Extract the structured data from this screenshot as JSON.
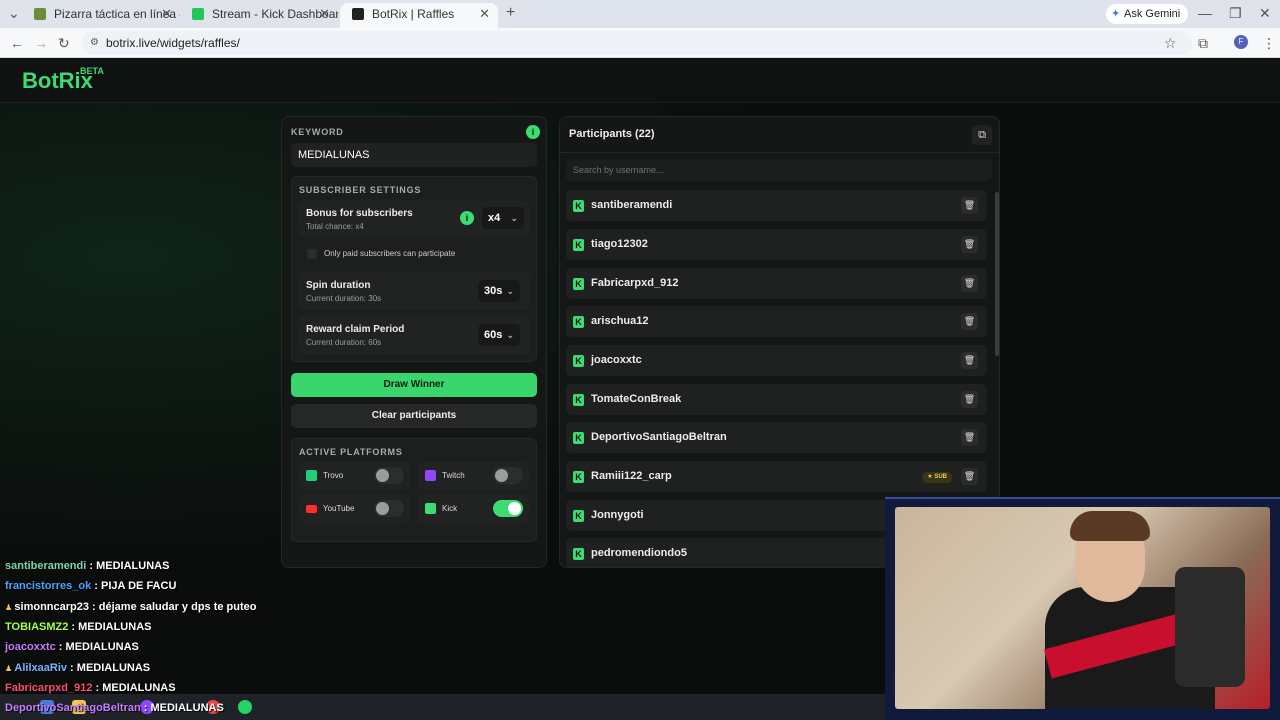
{
  "browser": {
    "tabs": [
      {
        "title": "Pizarra táctica en línea – Fútbol",
        "color": "#6b8e3a"
      },
      {
        "title": "Stream - Kick Dashboard",
        "color": "#22c55e"
      },
      {
        "title": "BotRix | Raffles",
        "color": "#222222"
      }
    ],
    "url": "botrix.live/widgets/raffles/",
    "gemini": "Ask Gemini",
    "profile": "F"
  },
  "app": {
    "logo": "BotRix",
    "beta": "BETA"
  },
  "raffle": {
    "keyword_label": "KEYWORD",
    "keyword_value": "MEDIALUNAS",
    "subscriber_settings": "SUBSCRIBER SETTINGS",
    "bonus_title": "Bonus for subscribers",
    "bonus_sub": "Total chance: x4",
    "bonus_value": "x4",
    "paid_only": "Only paid subscribers can participate",
    "spin_title": "Spin duration",
    "spin_sub": "Current duration: 30s",
    "spin_value": "30s",
    "reward_title": "Reward claim Period",
    "reward_sub": "Current duration: 60s",
    "reward_value": "60s",
    "draw_btn": "Draw Winner",
    "clear_btn": "Clear participants",
    "active_platforms": "ACTIVE PLATFORMS",
    "platforms": [
      {
        "name": "Trovo",
        "on": false
      },
      {
        "name": "Twitch",
        "on": false
      },
      {
        "name": "YouTube",
        "on": false
      },
      {
        "name": "Kick",
        "on": true
      }
    ]
  },
  "participants": {
    "title": "Participants (22)",
    "search_placeholder": "Search by username...",
    "sub_badge": "★ SUB",
    "list": [
      "santiberamendi",
      "tiago12302",
      "Fabricarpxd_912",
      "arischua12",
      "joacoxxtc",
      "TomateConBreak",
      "DeportivoSantiagoBeltran",
      "Ramiii122_carp",
      "Jonnygoti",
      "pedromendiondo5"
    ]
  },
  "chat": [
    {
      "user": "santiberamendi",
      "msg": "MEDIALUNAS",
      "color": "#7dd8a8"
    },
    {
      "user": "francistorres_ok",
      "msg": "PIJA DE FACU",
      "color": "#4aa3ff"
    },
    {
      "user": "simonncarp23",
      "msg": "déjame saludar y dps te puteo",
      "color": "#ffffff"
    },
    {
      "user": "TOBIASMZ2",
      "msg": "MEDIALUNAS",
      "color": "#a6ff4d"
    },
    {
      "user": "joacoxxtc",
      "msg": "MEDIALUNAS",
      "color": "#c77dff"
    },
    {
      "user": "AlilxaaRiv",
      "msg": "MEDIALUNAS",
      "color": "#7fb3ff"
    },
    {
      "user": "Fabricarpxd_912",
      "msg": "MEDIALUNAS",
      "color": "#ff4d6d"
    },
    {
      "user": "DeportivoSantiagoBeltran",
      "msg": "MEDIALUNAS",
      "color": "#c77dff"
    }
  ]
}
